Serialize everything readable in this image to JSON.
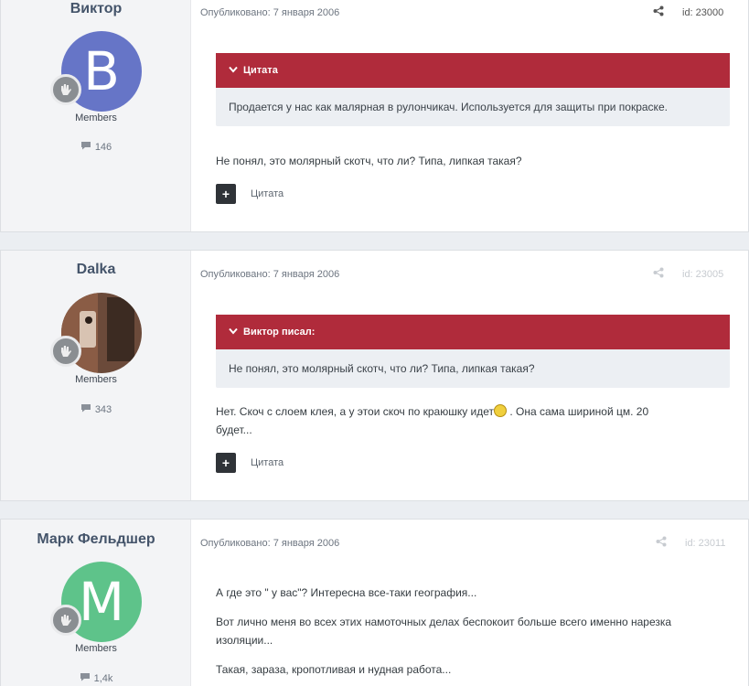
{
  "posts": [
    {
      "username": "Виктор",
      "avatar_letter": "B",
      "avatar_color": "#6675c7",
      "group": "Members",
      "post_count": "146",
      "published": "Опубликовано: 7 января 2006",
      "post_id": "id: 23000",
      "quote_header": "Цитата",
      "quote_text": "Продается у нас как малярная в рулончикач. Используется для защиты при покраске.",
      "body": [
        "Не понял, это молярный скотч, что ли? Типа, липкая такая?"
      ],
      "quote_button": "Цитата"
    },
    {
      "username": "Dalka",
      "avatar_letter": "",
      "group": "Members",
      "post_count": "343",
      "published": "Опубликовано: 7 января 2006",
      "post_id": "id: 23005",
      "quote_header": "Виктор писал:",
      "quote_text": "Не понял, это молярный скотч, что ли? Типа, липкая такая?",
      "body_line1_a": "Нет. Скоч с слоем клея, а у этои скоч по краюшку идет",
      "body_line1_b": " . Она сама шириной цм. 20",
      "body_line2": "будет...",
      "quote_button": "Цитата"
    },
    {
      "username": "Марк Фельдшер",
      "avatar_letter": "M",
      "avatar_color": "#5ec38a",
      "group": "Members",
      "post_count": "1,4k",
      "published": "Опубликовано: 7 января 2006",
      "post_id": "id: 23011",
      "body": [
        "А где это \" у вас\"? Интересна все-таки география...",
        "Вот лично меня во всех этих намоточных делах беспокоит больше всего именно нарезка изоляции...",
        "Такая, зараза, кропотливая и нудная работа..."
      ]
    }
  ],
  "icons": {
    "share": "share-icon",
    "comment": "comment-icon",
    "chevron": "chevron-down-icon",
    "badge": "hand-badge-icon",
    "plus": "plus-icon",
    "smiley": "smiley-icon"
  }
}
